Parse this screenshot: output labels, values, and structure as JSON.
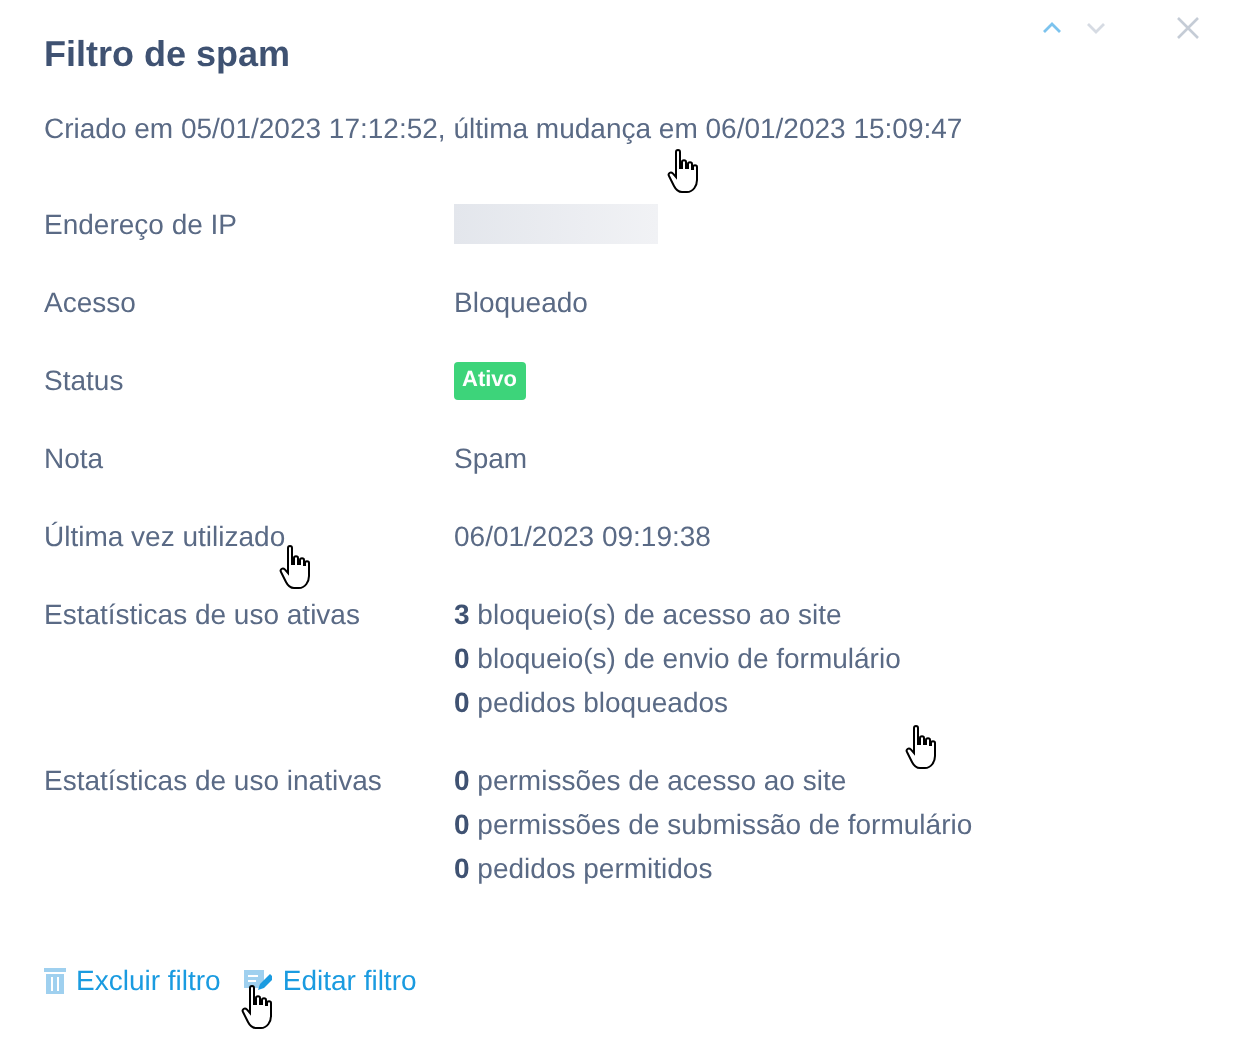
{
  "panel": {
    "title": "Filtro de spam",
    "subtitle": "Criado em 05/01/2023 17:12:52, última mudança em 06/01/2023 15:09:47",
    "nav": [
      {
        "kind": "up",
        "disabled": false
      },
      {
        "kind": "down",
        "disabled": true
      }
    ],
    "fields": [
      {
        "label": "Endereço de IP",
        "kind": "redacted"
      },
      {
        "label": "Acesso",
        "kind": "text",
        "value": "Bloqueado"
      },
      {
        "label": "Status",
        "kind": "badge",
        "value": "Ativo",
        "color": "#3dd47a"
      },
      {
        "label": "Nota",
        "kind": "text",
        "value": "Spam"
      },
      {
        "label": "Última vez utilizado",
        "kind": "text",
        "value": "06/01/2023 09:19:38"
      },
      {
        "label": "Estatísticas de uso ativas",
        "kind": "lines",
        "lines": [
          "**3** bloqueio(s) de acesso ao site",
          "**0** bloqueio(s) de envio de formulário",
          "**0** pedidos bloqueados"
        ]
      },
      {
        "label": "Estatísticas de uso inativas",
        "kind": "lines",
        "lines": [
          "**0** permissões de acesso ao site",
          "**0** permissões de submissão de formulário",
          "**0** pedidos permitidos"
        ]
      }
    ],
    "actions": [
      {
        "kind": "delete",
        "label": "Excluir filtro"
      },
      {
        "kind": "edit",
        "label": "Editar filtro"
      }
    ]
  }
}
